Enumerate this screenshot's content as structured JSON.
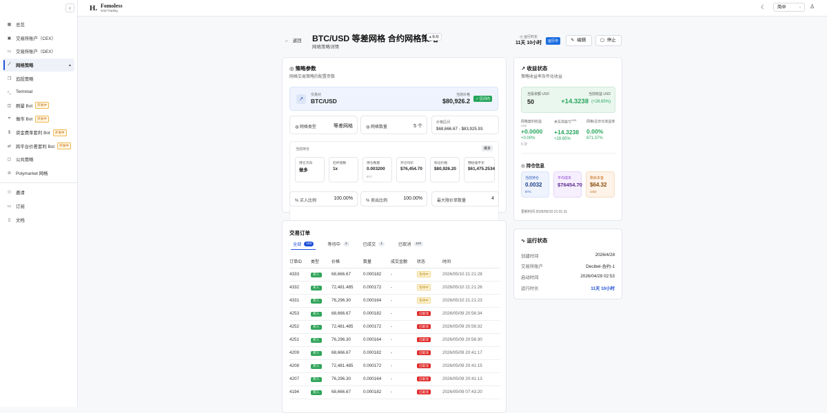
{
  "sidebar": {
    "items": [
      {
        "icon": "grid-icon",
        "label": "总览"
      },
      {
        "icon": "bank-icon",
        "label": "交易所账户（CEX）"
      },
      {
        "icon": "wallet-icon",
        "label": "交易所账户（DEX）"
      },
      {
        "icon": "line-chart-icon",
        "label": "网格策略",
        "active": true
      },
      {
        "icon": "copy-icon",
        "label": "追投策略"
      },
      {
        "icon": "terminal-icon",
        "label": "Terminal"
      },
      {
        "icon": "bot-icon",
        "label": "刷量 Bot",
        "badge": "开发中"
      },
      {
        "icon": "market-icon",
        "label": "做市 Bot",
        "badge": "开发中"
      },
      {
        "icon": "dollar-icon",
        "label": "资金费率套利 Bot",
        "badge": "开发中"
      },
      {
        "icon": "swap-icon",
        "label": "跨平台价差套利 Bot",
        "badge": "开发中"
      },
      {
        "icon": "strategy-icon",
        "label": "公共策略"
      },
      {
        "icon": "polymarket-icon",
        "label": "Polymarket 网格"
      }
    ],
    "bottom_items": [
      {
        "icon": "users-icon",
        "label": "邀请"
      },
      {
        "icon": "card-icon",
        "label": "订阅"
      },
      {
        "icon": "book-icon",
        "label": "文档"
      }
    ]
  },
  "topbar": {
    "logo_mark": "H.",
    "brand": "Fomoless",
    "brand_sub": "Grid Trading",
    "lang": "简中"
  },
  "header": {
    "back": "返回",
    "title": "BTC/USD 等差网格 合约网格策略",
    "private": "私有",
    "subtitle": "网格策略详情",
    "runtime_label": "运行时长",
    "runtime_value": "11天 10小时",
    "status": "运行中",
    "edit": "编辑",
    "stop": "停止"
  },
  "params": {
    "title": "策略参数",
    "subtitle": "网格交易策略的配置参数",
    "pair_label": "交易对",
    "pair": "BTC/USD",
    "price_label": "当前价格",
    "price": "$80,926.2",
    "price_status": "✓ 区间内",
    "grid_type_label": "网格类型",
    "grid_type": "等差网格",
    "grid_count_label": "网格数量",
    "grid_count": "5 个",
    "range_label": "价格区间",
    "range": "$68,666.67 - $83,925.93",
    "position_title": "当前持仓",
    "position_btn": "做多",
    "pos_cards": [
      {
        "label": "持仓方向",
        "value": "做多",
        "unit": ""
      },
      {
        "label": "杠杆倍数",
        "value": "1x",
        "unit": ""
      },
      {
        "label": "持仓数量",
        "value": "0.003200",
        "unit": "BTC"
      },
      {
        "label": "开仓均价",
        "value": "$76,454.70",
        "unit": ""
      },
      {
        "label": "标记价格",
        "value": "$80,926.20",
        "unit": ""
      },
      {
        "label": "预估强平价",
        "value": "$61,475.2534",
        "unit": ""
      }
    ],
    "buy_ratio_label": "买入比例",
    "buy_ratio": "100.00%",
    "sell_ratio_label": "卖出比例",
    "sell_ratio": "100.00%",
    "max_orders_label": "最大限价单数量",
    "max_orders": "4"
  },
  "orders": {
    "title": "交易订单",
    "tabs": [
      {
        "label": "全部",
        "count": "162"
      },
      {
        "label": "等待中",
        "count": "4"
      },
      {
        "label": "已成交",
        "count": "1"
      },
      {
        "label": "已取消",
        "count": "157"
      }
    ],
    "columns": [
      "订单ID",
      "类型",
      "价格",
      "数量",
      "成交金额",
      "状态",
      "时间"
    ],
    "rows": [
      {
        "id": "4333",
        "type": "买入",
        "price": "68,666.67",
        "qty": "0.000182",
        "amount": "-",
        "status": "等待中",
        "time": "2026/05/10 21:21:28"
      },
      {
        "id": "4332",
        "type": "买入",
        "price": "72,481.485",
        "qty": "0.000172",
        "amount": "-",
        "status": "等待中",
        "time": "2026/05/10 21:21:26"
      },
      {
        "id": "4331",
        "type": "买入",
        "price": "76,296.30",
        "qty": "0.000164",
        "amount": "-",
        "status": "等待中",
        "time": "2026/05/10 21:21:23"
      },
      {
        "id": "4253",
        "type": "买入",
        "price": "68,666.67",
        "qty": "0.000182",
        "amount": "-",
        "status": "已取消",
        "time": "2026/05/09 20:56:34"
      },
      {
        "id": "4252",
        "type": "买入",
        "price": "72,481.485",
        "qty": "0.000172",
        "amount": "-",
        "status": "已取消",
        "time": "2026/05/09 20:56:32"
      },
      {
        "id": "4251",
        "type": "买入",
        "price": "76,296.30",
        "qty": "0.000164",
        "amount": "-",
        "status": "已取消",
        "time": "2026/05/09 20:56:30"
      },
      {
        "id": "4209",
        "type": "买入",
        "price": "68,666.67",
        "qty": "0.000182",
        "amount": "-",
        "status": "已取消",
        "time": "2026/05/09 20:41:17"
      },
      {
        "id": "4208",
        "type": "买入",
        "price": "72,481.485",
        "qty": "0.000172",
        "amount": "-",
        "status": "已取消",
        "time": "2026/05/09 20:41:15"
      },
      {
        "id": "4207",
        "type": "买入",
        "price": "76,296.30",
        "qty": "0.000164",
        "amount": "-",
        "status": "已取消",
        "time": "2026/05/09 20:41:13"
      },
      {
        "id": "4194",
        "type": "买入",
        "price": "68,666.67",
        "qty": "0.000182",
        "amount": "-",
        "status": "已取消",
        "time": "2026/05/09 07:43:20"
      }
    ]
  },
  "profit": {
    "title": "收益状态",
    "subtitle": "策略收益率及年化收益",
    "invest_label": "当投资额 USD",
    "invest": "50",
    "current_label": "当前收益 USD",
    "current": "+14.3238",
    "current_pct": "(+28.65%)",
    "grid_label": "网格套利收益",
    "grid_unit": "USD",
    "grid": "+0.0000",
    "grid_pct": "+0.00%",
    "grid_count": "0 次",
    "unreal_label": "未实现盈亏",
    "unreal_unit": "USD",
    "unreal": "+14.3238",
    "unreal_pct": "+28.65%",
    "annual_label": "网格/总年化收益率",
    "annual_grid": "0.00%",
    "annual_total": "871.37%",
    "holding_title": "持仓信息",
    "hold_qty_label": "当前持仓",
    "hold_qty": "0.0032",
    "hold_qty_unit": "BTC",
    "avg_label": "平均成本",
    "avg": "$76454.70",
    "base_label": "剩余本金",
    "base": "$64.32",
    "base_unit": "USD",
    "updated": "更新时间 2026/05/10 21:31:11"
  },
  "run": {
    "title": "运行状态",
    "rows": [
      {
        "label": "创建时间",
        "value": "2026/4/28"
      },
      {
        "label": "交易所账户",
        "value": "Decibel-合约-1"
      },
      {
        "label": "启动时间",
        "value": "2026/04/29 02:53"
      },
      {
        "label": "运行时长",
        "value": "11天 10小时"
      }
    ]
  },
  "colors": {
    "accent": "#1d4ed8",
    "green": "#25a55a",
    "red": "#e02929"
  }
}
